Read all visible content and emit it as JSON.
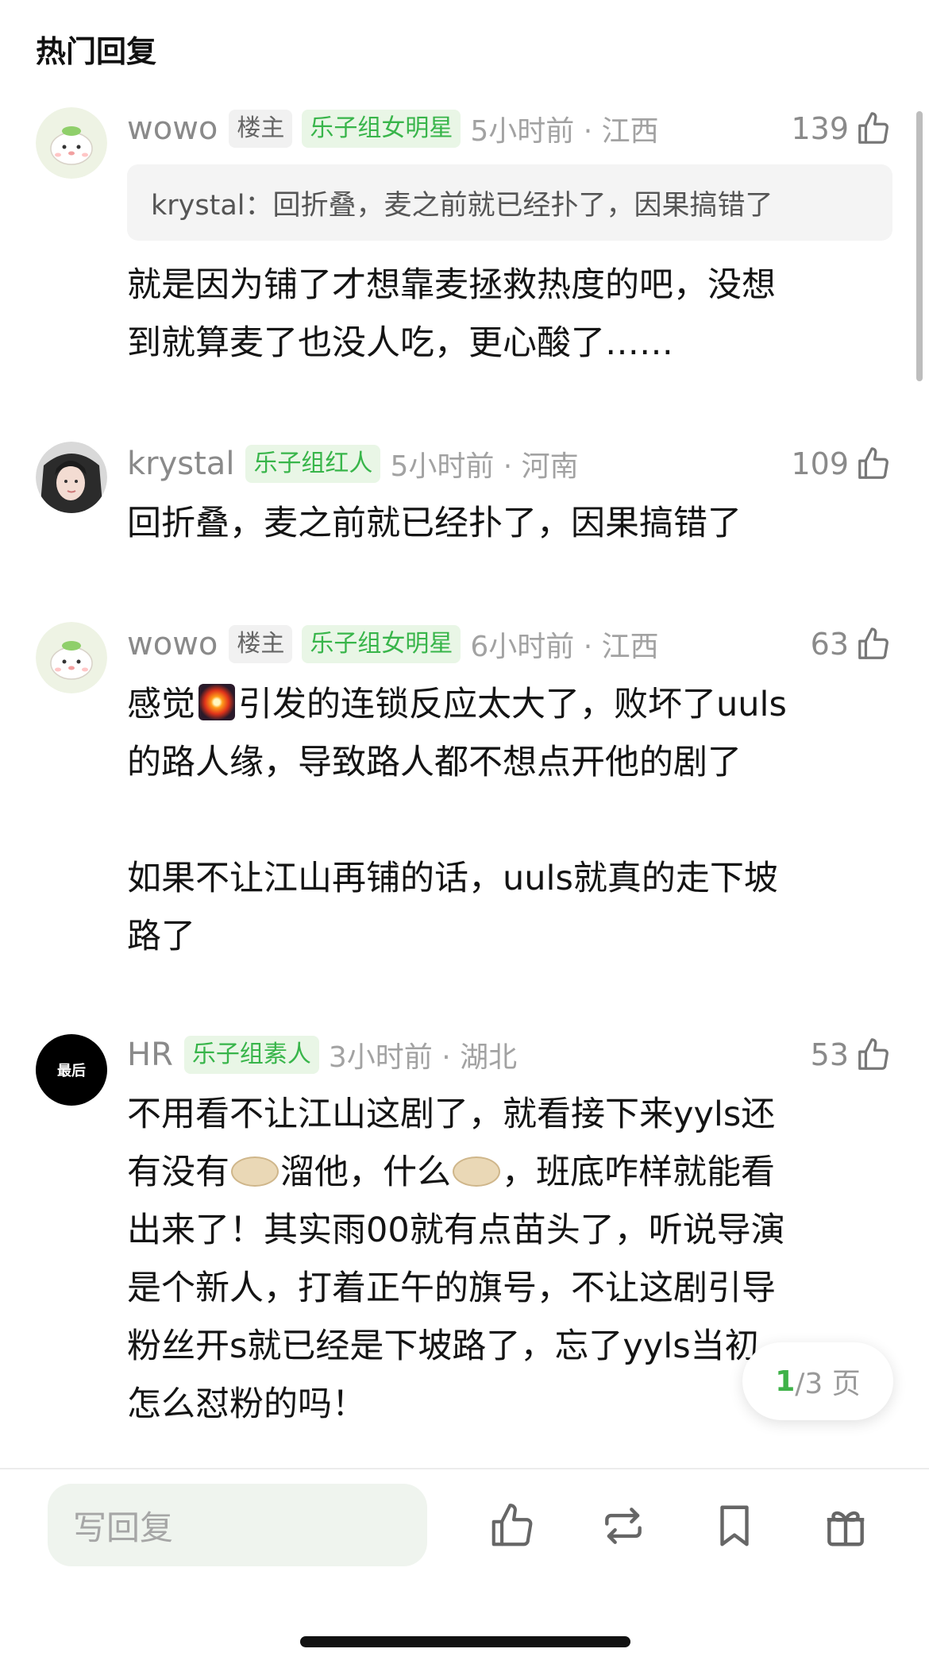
{
  "section": {
    "title": "热门回复"
  },
  "comments": [
    {
      "username": "wowo",
      "host_tag": "楼主",
      "group_tag": "乐子组女明星",
      "time": "5小时前 · 江西",
      "likes": "139",
      "quote": "krystal：回折叠，麦之前就已经扑了，因果搞错了",
      "text": [
        "就是因为铺了才想靠麦拯救热度的吧，没想",
        "到就算麦了也没人吃，更心酸了……"
      ]
    },
    {
      "username": "krystal",
      "group_tag": "乐子组红人",
      "time": "5小时前 · 河南",
      "likes": "109",
      "text": [
        "回折叠，麦之前就已经扑了，因果搞错了"
      ]
    },
    {
      "username": "wowo",
      "host_tag": "楼主",
      "group_tag": "乐子组女明星",
      "time": "6小时前 · 江西",
      "likes": "63",
      "text_a": "感觉",
      "text_b": "引发的连锁反应太大了，败坏了uuls",
      "text_c": "的路人缘，导致路人都不想点开他的剧了",
      "text_d": "如果不让江山再铺的话，uuls就真的走下坡",
      "text_e": "路了"
    },
    {
      "username": "HR",
      "avatar_text": "最后",
      "group_tag": "乐子组素人",
      "time": "3小时前 · 湖北",
      "likes": "53",
      "line1": "不用看不让江山这剧了，就看接下来yyls还",
      "line2_a": "有没有",
      "line2_b": "溜他，什么",
      "line2_c": "，班底咋样就能看",
      "line3": "出来了！其实雨00就有点苗头了，听说导演",
      "line4": "是个新人，打着正午的旗号，不让这剧引导",
      "line5": "粉丝开s就已经是下坡路了，忘了yyls当初",
      "line6": "怎么怼粉的吗！"
    }
  ],
  "pager": {
    "current": "1",
    "total": "/3 页"
  },
  "bottom_bar": {
    "reply_placeholder": "写回复",
    "icons": [
      "like-icon",
      "repost-icon",
      "bookmark-icon",
      "gift-icon"
    ]
  },
  "colors": {
    "accent": "#3fb249",
    "tag_bg": "#e9f6e6"
  }
}
